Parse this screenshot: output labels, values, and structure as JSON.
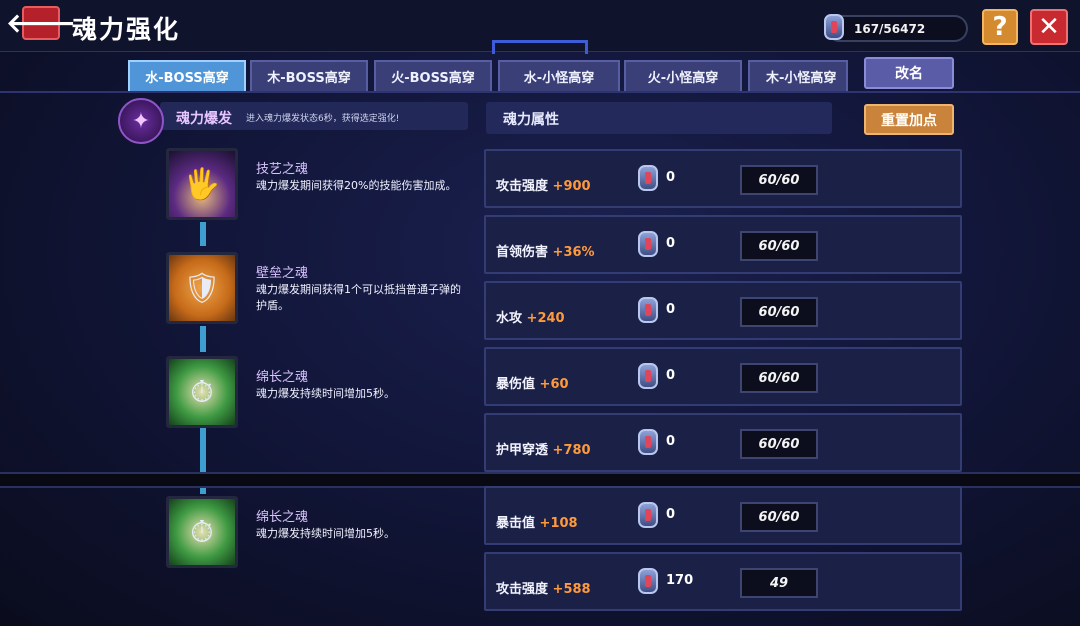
{
  "header": {
    "title": "魂力强化",
    "back_symbol": "🡐",
    "currency_text": "167/56472",
    "help_symbol": "?",
    "close_symbol": "✕"
  },
  "tabs": [
    {
      "label": "水-BOSS高穿",
      "active": true
    },
    {
      "label": "木-BOSS高穿",
      "active": false
    },
    {
      "label": "火-BOSS高穿",
      "active": false
    },
    {
      "label": "水-小怪高穿",
      "active": false
    },
    {
      "label": "火-小怪高穿",
      "active": false
    },
    {
      "label": "木-小怪高穿",
      "active": false
    }
  ],
  "rename_label": "改名",
  "burst": {
    "title": "魂力爆发",
    "desc": "进入魂力爆发状态6秒，获得选定强化!"
  },
  "skills": [
    {
      "name": "技艺之魂",
      "desc": "魂力爆发期间获得20%的技能伤害加成。",
      "icon": "claw-icon"
    },
    {
      "name": "壁垒之魂",
      "desc": "魂力爆发期间获得1个可以抵挡普通子弹的护盾。",
      "icon": "shield-icon"
    },
    {
      "name": "绵长之魂",
      "desc": "魂力爆发持续时间增加5秒。",
      "icon": "clock-icon"
    },
    {
      "name": "绵长之魂",
      "desc": "魂力爆发持续时间增加5秒。",
      "icon": "clock-icon"
    }
  ],
  "attributes": {
    "header": "魂力属性",
    "reset_label": "重置加点",
    "rows": [
      {
        "name": "攻击强度",
        "bonus": "+900",
        "count": "0",
        "value": "60/60"
      },
      {
        "name": "首领伤害",
        "bonus": "+36%",
        "count": "0",
        "value": "60/60"
      },
      {
        "name": "水攻",
        "bonus": "+240",
        "count": "0",
        "value": "60/60"
      },
      {
        "name": "暴伤值",
        "bonus": "+60",
        "count": "0",
        "value": "60/60"
      },
      {
        "name": "护甲穿透",
        "bonus": "+780",
        "count": "0",
        "value": "60/60"
      },
      {
        "name": "暴击值",
        "bonus": "+108",
        "count": "0",
        "value": "60/60"
      },
      {
        "name": "攻击强度",
        "bonus": "+588",
        "count": "170",
        "value": "49"
      }
    ]
  },
  "colors": {
    "active_tab": "#4f95d8",
    "bonus": "#ff9a3c",
    "close_button": "#c92a30",
    "help_button": "#d48a2e"
  }
}
